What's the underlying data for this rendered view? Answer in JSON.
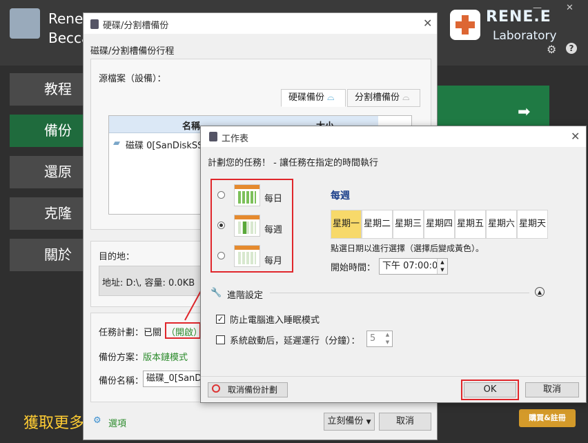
{
  "app": {
    "title_line1": "Rene",
    "title_line2": "Becca",
    "brand_name": "RENE.E",
    "brand_sub": "Laboratory",
    "footer_text": "獲取更多",
    "buy_button": "購買&註冊",
    "nav": [
      "教程",
      "備份",
      "還原",
      "克隆",
      "關於"
    ],
    "colors": {
      "accent_green": "#1f7a44",
      "footer_yellow": "#ffcc33",
      "highlight_red": "#e0262b"
    }
  },
  "backup_dialog": {
    "title": "硬碟/分割槽備份",
    "heading": "磁碟/分割槽備份行程",
    "source_label": "源檔案（設備）：",
    "tabs": [
      "硬碟備份",
      "分割槽備份"
    ],
    "list_header": {
      "name": "名稱",
      "size": "大小"
    },
    "disk_item": "磁碟 0[SanDiskSS",
    "dest_label": "目的地：",
    "dest_value": "地址: D:\\, 容量: 0.0KB",
    "task_plan_label": "任務計劃：已關",
    "task_plan_link": "（開啟）",
    "scheme_label": "備份方案：",
    "scheme_value": "版本鏈模式",
    "backup_name_label": "備份名稱：",
    "backup_name_value": "磁碟_0[SanD",
    "options_link": "選項",
    "backup_now_button": "立刻備份",
    "cancel_button": "取消"
  },
  "schedule_dialog": {
    "title": "工作表",
    "heading": "計劃您的任務！ - 讓任務在指定的時間執行",
    "options": [
      {
        "label": "每日",
        "selected": false
      },
      {
        "label": "每週",
        "selected": true
      },
      {
        "label": "每月",
        "selected": false
      }
    ],
    "section_title": "每週",
    "days": [
      "星期一",
      "星期二",
      "星期三",
      "星期四",
      "星期五",
      "星期六",
      "星期天"
    ],
    "selected_day": "星期一",
    "hint": "點選日期以進行選擇（選擇后變成黃色）。",
    "start_time_label": "開始時間：",
    "start_time_value": "下午 07:00:0(",
    "advanced_label": "進階設定",
    "prevent_sleep_label": "防止電腦進入睡眠模式",
    "prevent_sleep_checked": true,
    "delay_label": "系統啟動后，延遲運行（分鐘）：",
    "delay_checked": false,
    "delay_value": "5",
    "cancel_plan_button": "取消備份計劃",
    "ok_button": "OK",
    "cancel_button": "取消"
  }
}
